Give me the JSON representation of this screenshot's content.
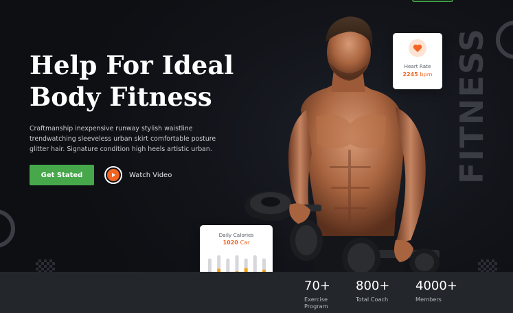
{
  "hero": {
    "headline_line1": "Help For Ideal",
    "headline_line2": "Body Fitness",
    "description": "Craftmanship inexpensive runway stylish waistline trendwatching sleeveless urban skirt comfortable posture glitter hair. Signature condition high heels artistic urban.",
    "primary_button": "Get Stated",
    "video_button": "Watch Video",
    "vertical_word": "FITNESS"
  },
  "heart_card": {
    "label": "Heart Rate",
    "value": "2245",
    "unit": "bpm",
    "icon": "heart-icon"
  },
  "calories_card": {
    "label": "Daily Calories",
    "value": "1020",
    "unit": "Car",
    "bars": [
      0.45,
      0.58,
      0.42,
      0.5,
      0.6,
      0.46,
      0.55
    ]
  },
  "stats": [
    {
      "number": "70+",
      "label": "Exercise Program"
    },
    {
      "number": "800+",
      "label": "Total Coach"
    },
    {
      "number": "4000+",
      "label": "Members"
    }
  ],
  "colors": {
    "accent_green": "#46a84a",
    "accent_orange": "#f26522",
    "stats_bg": "#23272b",
    "page_bg": "#0f1116"
  }
}
